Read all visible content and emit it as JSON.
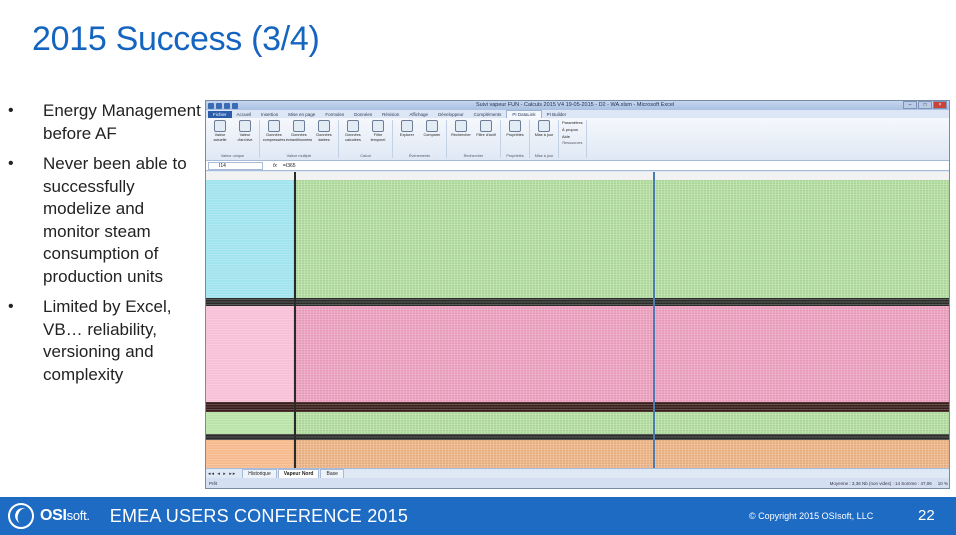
{
  "slide": {
    "title": "2015 Success (3/4)",
    "bullets": [
      "Energy Management before AF",
      "Never been able to successfully modelize and monitor steam consumption of production units",
      "Limited by Excel, VB… reliability, versioning and complexity"
    ]
  },
  "excel": {
    "window_title": "Suivi vapeur FUN - Calculs 2015 V4 19-05-2015 - D2 - WA.xlsm - Microsoft Excel",
    "tabs": [
      "Fichier",
      "Accueil",
      "Insertion",
      "Mise en page",
      "Formules",
      "Données",
      "Révision",
      "Affichage",
      "Développeur",
      "Compléments",
      "PI DataLink",
      "PI Builder"
    ],
    "active_tab": "PI DataLink",
    "ribbon_groups": [
      {
        "label": "Valeur unique",
        "buttons": [
          "Valeur actuelle",
          "Valeur d'archive"
        ]
      },
      {
        "label": "Valeur multiple",
        "buttons": [
          "Données compressées",
          "Données échantillonnées",
          "Données datées"
        ]
      },
      {
        "label": "Calcul",
        "buttons": [
          "Données calculées",
          "Filtre temporel"
        ]
      },
      {
        "label": "Événements",
        "buttons": [
          "Explorer",
          "Comparer"
        ]
      },
      {
        "label": "Rechercher",
        "buttons": [
          "Rechercher",
          "Filtre d'actif"
        ]
      },
      {
        "label": "Propriétés",
        "buttons": [
          "Propriétés"
        ]
      },
      {
        "label": "Mise à jour",
        "buttons": [
          "Mise à jour"
        ]
      }
    ],
    "resources": {
      "label": "Ressources",
      "items": [
        "Paramètres",
        "À propos",
        "Aide"
      ]
    },
    "name_box": "I14",
    "formula": "=I365",
    "sheet_tabs": [
      "Historique",
      "Vapeur Nord",
      "Base"
    ],
    "active_sheet": "Vapeur Nord",
    "status_left": "Prêt",
    "status_right": "Moyenne : 3,36   Nb (non vides) : 14   Somme : 47,06",
    "zoom": "10 %",
    "colors": {
      "green": "#b9e3a6",
      "pink": "#f5a3c7",
      "cyan": "#9fe3ee",
      "orange": "#f6b98a"
    }
  },
  "footer": {
    "logo_main": "OSI",
    "logo_sub": "soft.",
    "conference": "EMEA USERS CONFERENCE 2015",
    "copyright": "© Copyright 2015 OSIsoft, LLC",
    "page": "22"
  }
}
